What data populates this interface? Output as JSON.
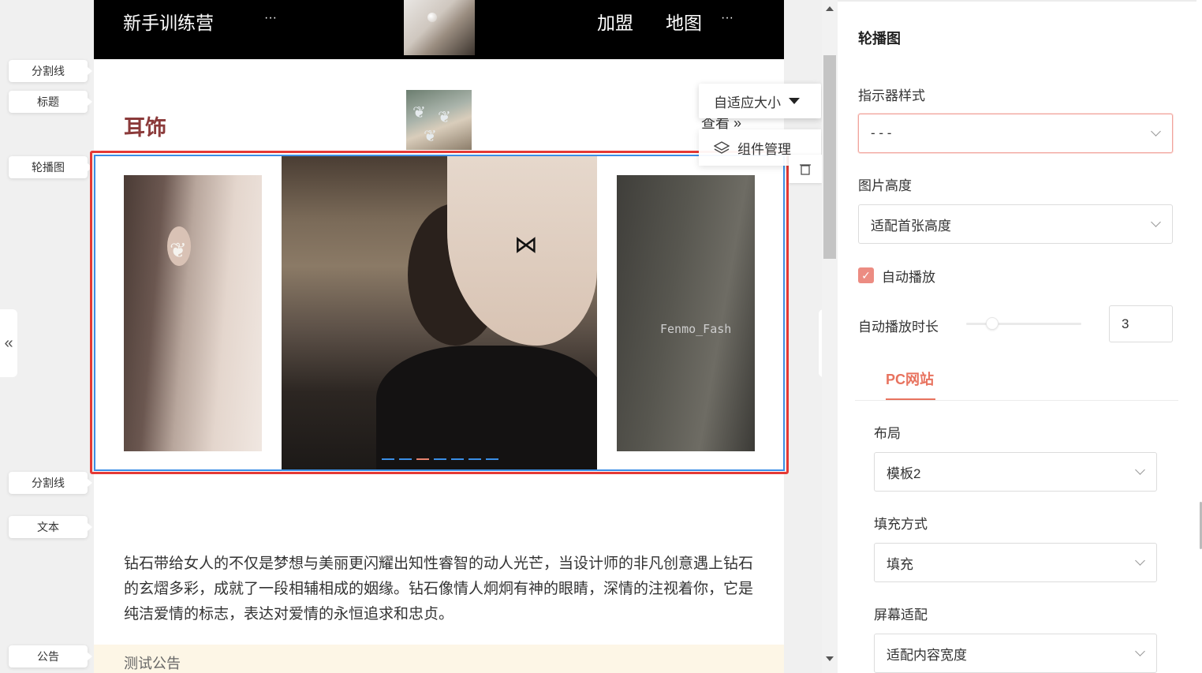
{
  "topnav": {
    "brand": "新手训练营",
    "more_left": "···",
    "nav_items": [
      "加盟",
      "地图"
    ],
    "more_right": "···"
  },
  "side_labels": {
    "divider_1": "分割线",
    "title": "标题",
    "carousel": "轮播图",
    "divider_2": "分割线",
    "text": "文本",
    "notice": "公告"
  },
  "section": {
    "title": "耳饰",
    "view_more": "查看"
  },
  "popup": {
    "size_option": "自适应大小",
    "manage": "组件管理"
  },
  "carousel": {
    "watermark": "Fenmo_Fash",
    "indicator_count": 7,
    "active_index": 2,
    "prev_icon": "«",
    "next_icon": "»"
  },
  "text_block": {
    "content": "钻石带给女人的不仅是梦想与美丽更闪耀出知性睿智的动人光芒，当设计师的非凡创意遇上钻石的玄熠多彩，成就了一段相辅相成的姻缘。钻石像情人炯炯有神的眼睛，深情的注视着你，它是纯洁爱情的标志，表达对爱情的永恒追求和忠贞。"
  },
  "notice": {
    "content": "测试公告"
  },
  "panel": {
    "title": "轮播图",
    "indicator_style_label": "指示器样式",
    "indicator_style_value": "- - -",
    "image_height_label": "图片高度",
    "image_height_value": "适配首张高度",
    "autoplay_label": "自动播放",
    "autoplay_checked": true,
    "autoplay_duration_label": "自动播放时长",
    "autoplay_duration_value": "3",
    "tab_label": "PC网站",
    "layout_label": "布局",
    "layout_value": "模板2",
    "fill_label": "填充方式",
    "fill_value": "填充",
    "screen_fit_label": "屏幕适配",
    "screen_fit_value": "适配内容宽度",
    "accent_color": "#e8735f"
  }
}
